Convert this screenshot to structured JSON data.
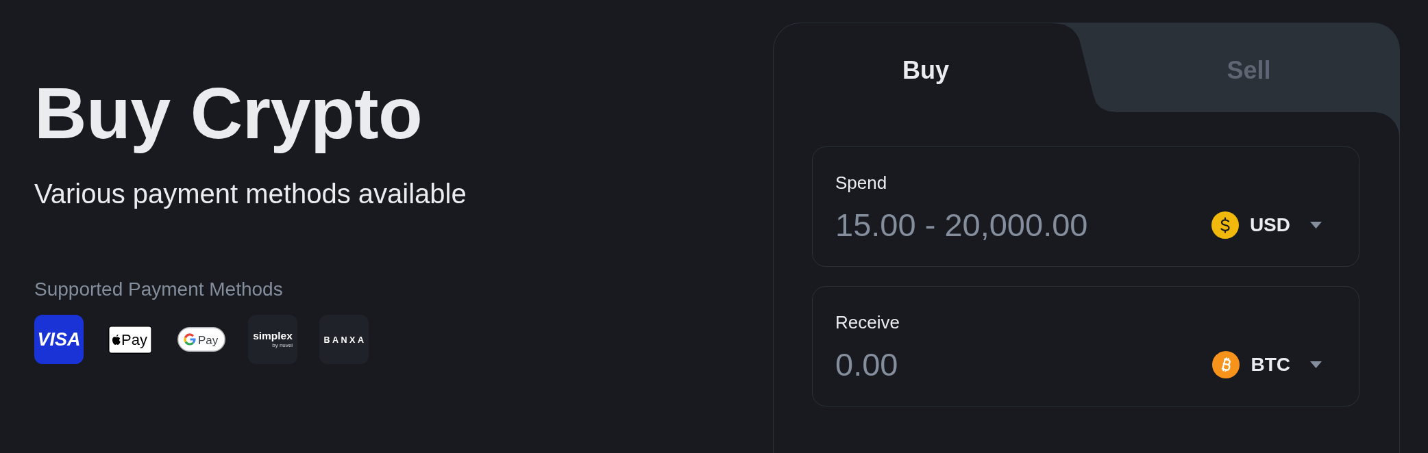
{
  "hero": {
    "title": "Buy Crypto",
    "subtitle": "Various payment methods available"
  },
  "payment_methods": {
    "title": "Supported Payment Methods",
    "items": [
      {
        "kind": "visa",
        "text": "VISA"
      },
      {
        "kind": "apple_pay",
        "text": "Pay"
      },
      {
        "kind": "google_pay",
        "text": "Pay"
      },
      {
        "kind": "simplex",
        "text": "simplex",
        "subtext": "by nuvei"
      },
      {
        "kind": "banxa",
        "text": "BANXA"
      }
    ]
  },
  "trade_card": {
    "tabs": [
      {
        "label": "Buy",
        "selected": true
      },
      {
        "label": "Sell",
        "selected": false
      }
    ],
    "fields": [
      {
        "label": "Spend",
        "placeholder": "15.00 - 20,000.00",
        "currency": {
          "code": "USD",
          "kind": "fiat"
        }
      },
      {
        "label": "Receive",
        "placeholder": "0.00",
        "currency": {
          "code": "BTC",
          "kind": "crypto"
        }
      }
    ]
  }
}
